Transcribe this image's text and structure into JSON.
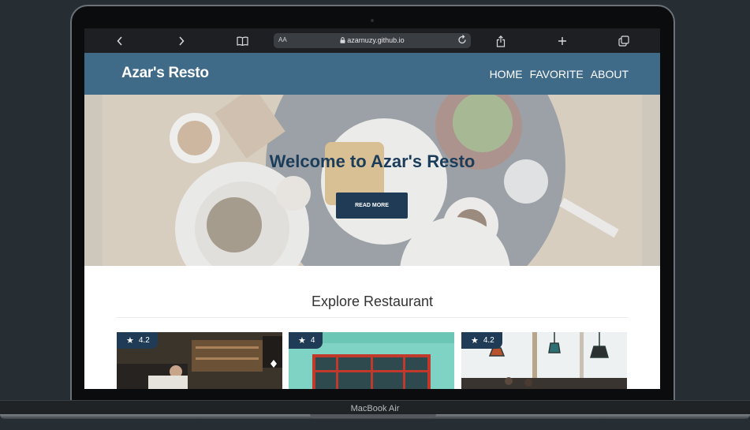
{
  "browser": {
    "url": "azarnuzy.github.io",
    "text_size_label": "AA"
  },
  "navbar": {
    "brand": "Azar's Resto",
    "links": [
      "HOME",
      "FAVORITE",
      "ABOUT"
    ]
  },
  "hero": {
    "title": "Welcome to Azar's Resto",
    "button_label": "READ MORE"
  },
  "explore": {
    "title": "Explore Restaurant",
    "cards": [
      {
        "rating": "4.2"
      },
      {
        "rating": "4"
      },
      {
        "rating": "4.2"
      }
    ]
  },
  "device": {
    "label": "MacBook Air"
  },
  "colors": {
    "navbar": "#3f6a88",
    "accent": "#1f3b56",
    "hero_title": "#1c3d5a"
  }
}
